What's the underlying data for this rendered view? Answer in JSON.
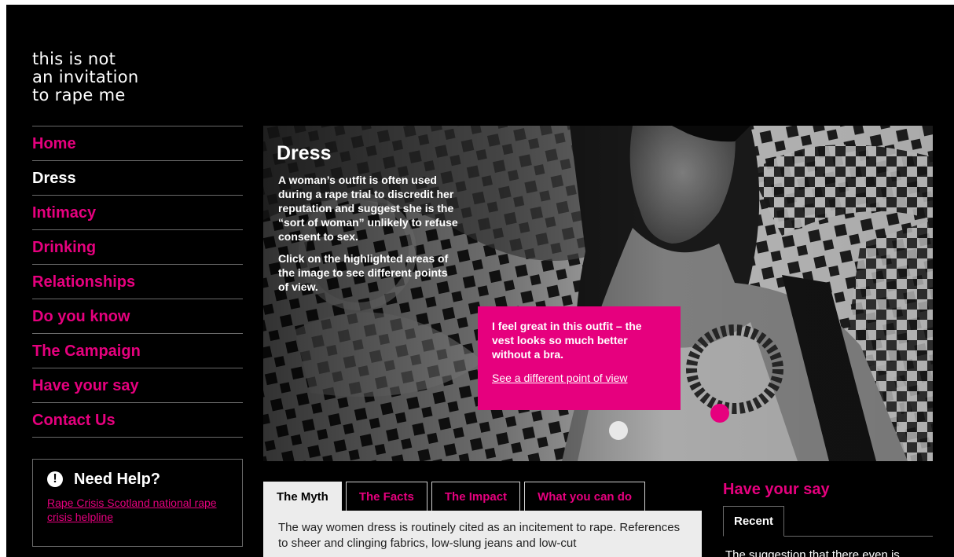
{
  "logo": {
    "lines": [
      "this is not",
      "an invitation",
      "to rape me"
    ]
  },
  "nav": {
    "items": [
      {
        "label": "Home"
      },
      {
        "label": "Dress"
      },
      {
        "label": "Intimacy"
      },
      {
        "label": "Drinking"
      },
      {
        "label": "Relationships"
      },
      {
        "label": "Do you know"
      },
      {
        "label": "The Campaign"
      },
      {
        "label": "Have your say"
      },
      {
        "label": "Contact Us"
      }
    ],
    "active_index": 1
  },
  "help": {
    "icon": "exclamation-circle-icon",
    "title": "Need Help?",
    "link": "Rape Crisis Scotland national rape crisis helpline"
  },
  "hero": {
    "title": "Dress",
    "paragraphs": [
      "A woman’s outfit is often used during a rape trial to discredit her reputation and suggest she is the “sort of woman” unlikely to refuse consent to sex.",
      "Click on the highlighted areas of the image to see different points of view."
    ],
    "callout": {
      "text": "I feel great in this outfit – the vest looks so much better without a bra.",
      "link": "See a different point of view"
    }
  },
  "tabs": {
    "items": [
      {
        "label": "The Myth"
      },
      {
        "label": "The Facts"
      },
      {
        "label": "The Impact"
      },
      {
        "label": "What you can do"
      }
    ],
    "active_index": 0,
    "panel_text": "The way women dress is routinely cited as an incitement to rape. References to sheer and clinging fabrics, low-slung jeans and low-cut"
  },
  "say": {
    "title": "Have your say",
    "tab": "Recent",
    "text": "The suggestion that there even is"
  },
  "colors": {
    "accent": "#e6007e",
    "background": "#000000",
    "panel": "#ececec"
  }
}
